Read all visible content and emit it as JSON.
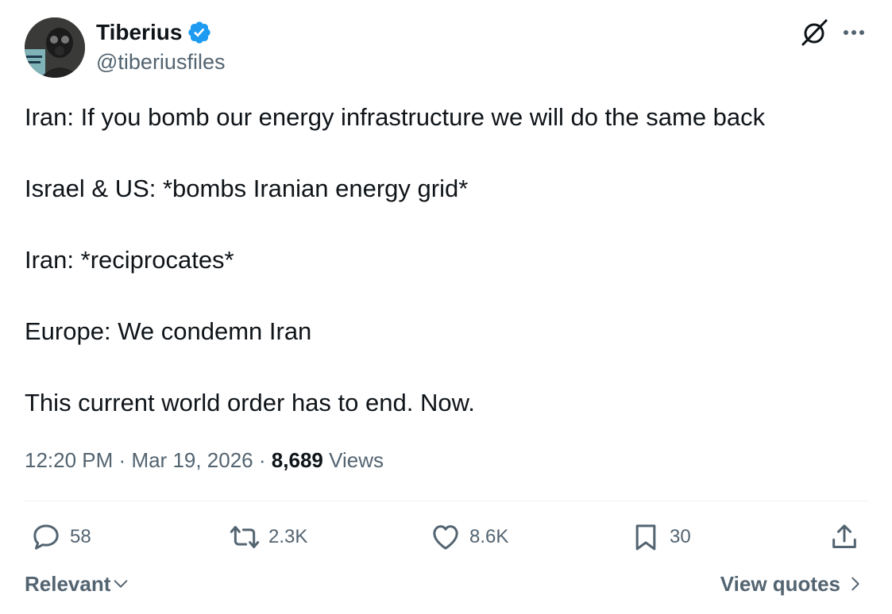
{
  "author": {
    "display_name": "Tiberius",
    "handle": "@tiberiusfiles",
    "verified": true
  },
  "tweet": {
    "lines": [
      "Iran: If you bomb our energy infrastructure we will do the same back",
      "Israel & US: *bombs Iranian energy grid*",
      "Iran: *reciprocates*",
      "Europe: We condemn Iran",
      "This current world order has to end. Now."
    ]
  },
  "meta": {
    "time": "12:20 PM",
    "separator": "·",
    "date": "Mar 19, 2026",
    "views_count": "8,689",
    "views_label": "Views"
  },
  "actions": {
    "replies": "58",
    "reposts": "2.3K",
    "likes": "8.6K",
    "bookmarks": "30"
  },
  "footer": {
    "sort_label": "Relevant",
    "view_quotes_label": "View quotes"
  },
  "colors": {
    "text": "#0f1419",
    "secondary": "#536471",
    "verified": "#1d9bf0",
    "divider": "#eff3f4"
  },
  "icons": [
    "avatar",
    "verified-badge-icon",
    "grok-icon",
    "more-icon",
    "reply-icon",
    "retweet-icon",
    "like-icon",
    "bookmark-icon",
    "share-icon",
    "chevron-down-icon",
    "chevron-right-icon"
  ]
}
